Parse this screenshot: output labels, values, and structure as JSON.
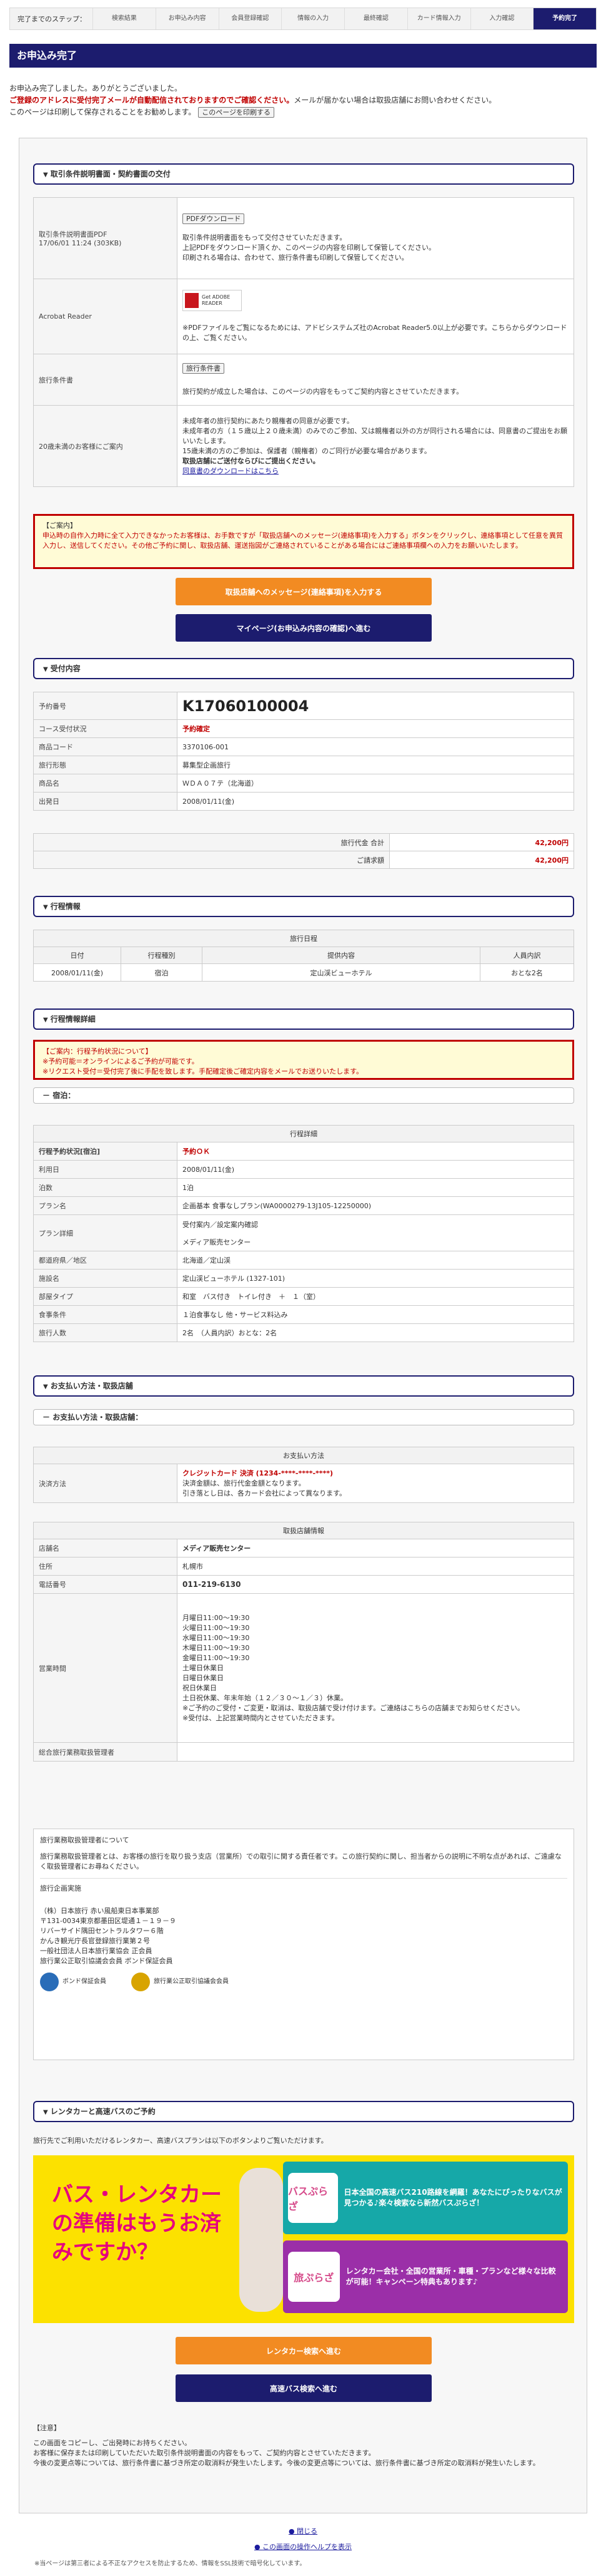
{
  "steps": {
    "current_label": "完了までのステップ：",
    "items": [
      "検索結果",
      "お申込み内容",
      "会員登録確認",
      "情報の入力",
      "最終確認",
      "カード情報入力",
      "入力確認",
      "予約完了"
    ]
  },
  "title": "お申込み完了",
  "intro": {
    "line1": "お申込み完了しました。ありがとうございました。",
    "line2_red": "ご登録のアドレスに受付完了メールが自動配信されておりますのでご確認ください。",
    "line2_rest": "メールが届かない場合は取扱店舗にお問い合わせください。",
    "line3": "このページは印刷して保存されることをお勧めします。",
    "print_button": "このページを印刷する"
  },
  "sec_docs": {
    "title": "取引条件説明書面・契約書面の交付",
    "rows": [
      {
        "label": "取引条件説明書面PDF",
        "sub": "17/06/01 11:24 (303KB)",
        "button": "PDFダウンロード",
        "text1": "取引条件説明書面をもって交付させていただきます。",
        "text2": "上記PDFをダウンロード頂くか、このページの内容を印刷して保管してください。",
        "text3": "印刷される場合は、合わせて、旅行条件書も印刷して保管してください。"
      },
      {
        "label": "Acrobat Reader",
        "logo_text": "Get ADOBE READER",
        "text1": "※PDFファイルをご覧になるためには、アドビシステムズ社のAcrobat Reader5.0以上が必要です。こちらからダウンロードの上、ご覧ください。"
      },
      {
        "label": "旅行条件書",
        "button": "旅行条件書",
        "text1": "旅行契約が成立した場合は、このページの内容をもってご契約内容とさせていただきます。"
      },
      {
        "label": "20歳未満のお客様にご案内",
        "text1": "未成年者の旅行契約にあたり親権者の同意が必要です。",
        "text2": "未成年者の方（１５歳以上２０歳未満）のみでのご参加、又は親権者以外の方が同行される場合には、同意書のご提出をお願いいたします。",
        "text3": "15歳未満の方のご参加は、保護者（親権者）のご同行が必要な場合があります。",
        "text4": "取扱店舗にご送付ならびにご提出ください。",
        "link": "同意書のダウンロードはこちら"
      }
    ]
  },
  "notice1": {
    "title": "【ご案内】",
    "body": "申込時の自作入力時に全て入力できなかったお客様は、お手数ですが「取扱店舗へのメッセージ(連絡事項)を入力する」ボタンをクリックし、連絡事項として任意を異質入力し、送信してください。その他ご予約に関し、取扱店舗、運送指図がご連絡されていることがある場合にはご連絡事項欄への入力をお願いいたします。"
  },
  "btn_message": "取扱店舗へのメッセージ(連絡事項)を入力する",
  "btn_mypage": "マイページ(お申込み内容の確認)へ進む",
  "sec_reception": {
    "title": "受付内容",
    "rows": [
      {
        "label": "予約番号",
        "value": "K17060100004"
      },
      {
        "label": "コース受付状況",
        "value": "予約確定"
      },
      {
        "label": "商品コード",
        "value": "3370106-001"
      },
      {
        "label": "旅行形態",
        "value": "募集型企画旅行"
      },
      {
        "label": "商品名",
        "value": "ＷＤＡ０７テ（北海道）"
      },
      {
        "label": "出発日",
        "value": "2008/01/11(金)"
      }
    ],
    "totals": [
      {
        "label": "旅行代金 合計",
        "value": "42,200円"
      },
      {
        "label": "ご請求額",
        "value": "42,200円"
      }
    ]
  },
  "sec_itinerary": {
    "title": "行程情報",
    "table_title": "旅行日程",
    "headers": [
      "日付",
      "行程種別",
      "提供内容",
      "人員内訳"
    ],
    "row": [
      "2008/01/11(金)",
      "宿泊",
      "定山渓ビューホテル",
      "おとな2名"
    ]
  },
  "sec_detail": {
    "title": "行程情報詳細",
    "notice_title": "【ご案内：行程予約状況について】",
    "notice_lines": [
      "※予約可能＝オンラインによるご予約が可能です。",
      "※リクエスト受付＝受付完了後に手配を致します。手配確定後ご確定内容をメールでお送りいたします。"
    ],
    "sub": "宿泊",
    "table_title": "行程詳細",
    "rows": [
      {
        "label": "行程予約状況[宿泊]",
        "value": "予約ＯＫ"
      },
      {
        "label": "利用日",
        "value": "2008/01/11(金)"
      },
      {
        "label": "泊数",
        "value": "1泊"
      },
      {
        "label": "プラン名",
        "value": "企画基本 食事なしプラン(WA0000279-13J105-12250000)"
      },
      {
        "label": "プラン詳細",
        "value": "受付案内／設定案内確認",
        "value2": "メディア販売センター"
      },
      {
        "label": "都道府県／地区",
        "value": "北海道／定山渓"
      },
      {
        "label": "施設名",
        "value": "定山渓ビューホテル (1327-101)"
      },
      {
        "label": "部屋タイプ",
        "value": "和室　バス付き　トイレ付き　＋　１（室）"
      },
      {
        "label": "食事条件",
        "value": "１泊食事なし 他・サービス料込み"
      },
      {
        "label": "旅行人数",
        "value": "2名　（人員内訳）おとな：2名"
      }
    ]
  },
  "sec_payment": {
    "title": "お支払い方法・取扱店舗",
    "sub": "お支払い方法・取扱店舗",
    "pay_title": "お支払い方法",
    "pay_label": "決済方法",
    "pay_value": "クレジットカード 決済 (1234-****-****-****)",
    "pay_note1": "決済金額は、旅行代金金額となります。",
    "pay_note2": "引き落とし日は、各カード会社によって異なります。",
    "shop_title": "取扱店舗情報",
    "shop_rows": [
      {
        "label": "店舗名",
        "value": "メディア販売センター"
      },
      {
        "label": "住所",
        "value": "札幌市"
      },
      {
        "label": "電話番号",
        "value": "011-219-6130"
      }
    ],
    "hours_label": "営業時間",
    "hours": [
      "月曜日11:00〜19:30",
      "火曜日11:00〜19:30",
      "水曜日11:00〜19:30",
      "木曜日11:00〜19:30",
      "金曜日11:00〜19:30",
      "土曜日休業日",
      "日曜日休業日",
      "祝日休業日",
      "土日祝休業、年末年始（１２／３０～１／３）休業。",
      "※ご予約のご受付・ご変更・取消は、取扱店舗で受け付けます。ご連絡はこちらの店舗までお知らせください。",
      "※受付は、上記営業時間内とさせていただきます。"
    ],
    "manager_label": "総合旅行業務取扱管理者",
    "manager_title": "旅行業務取扱管理者について",
    "manager_text": "旅行業務取扱管理者とは、お客様の旅行を取り扱う支店（営業所）での取引に関する責任者です。この旅行契約に関し、担当者からの説明に不明な点があれば、ご遠慮なく取扱管理者にお尋ねください。",
    "company_title": "旅行企画実施",
    "company_lines": [
      "（株）日本旅行 赤い風船東日本事業部",
      "〒131-0034東京都墨田区堤通１－１９－９",
      "リバーサイド隅田セントラルタワー６階",
      "かんき観光庁長官登録旅行業第２号",
      "一般社団法人日本旅行業協会 正会員",
      "旅行業公正取引協議会会員 ボンド保証会員"
    ],
    "logo1": "ボンド保証会員",
    "logo2": "旅行業公正取引協議会会員"
  },
  "sec_rental": {
    "title": "レンタカーと高速バスのご予約",
    "text": "旅行先でご利用いただけるレンタカー、高速バスプランは以下のボタンよりご覧いただけます。",
    "banner_main": "バス・レンタカーの準備はもうお済みですか？",
    "banner_bus": "日本全国の高速バス210路線を網羅！あなたにぴったりなバスが見つかる♪楽々検索なら新然バスぷらざ！",
    "banner_car": "レンタカー会社・全国の営業所・車種・プランなど様々な比較が可能！キャンペーン特典もあります♪",
    "brand_bus": "バスぷらざ",
    "brand_car": "旅ぷらざ",
    "btn_rental": "レンタカー検索へ進む",
    "btn_bus": "高速バス検索へ進む"
  },
  "caution": {
    "title": "【注意】",
    "lines": [
      "この画面をコピーし、ご出発時にお持ちください。",
      "お客様に保存または印刷していただいた取引条件説明書面の内容をもって、ご契約内容とさせていただきます。",
      "今後の変更点等については、旅行条件書に基づき所定の取消料が発生いたします。今後の変更点等については、旅行条件書に基づき所定の取消料が発生いたします。"
    ]
  },
  "footer": {
    "link_top": "閉じる",
    "link_help": "この画面の操作ヘルプを表示",
    "note": "※当ページは第三者による不正なアクセスを防止するため、情報をSSL技術で暗号化しています。"
  },
  "colors": {
    "navy": "#1c1c6e",
    "orange": "#f28b22",
    "red": "#c00000",
    "banner_yellow": "#fce100",
    "banner_teal": "#16a8a8",
    "banner_purple": "#9b2fa8"
  }
}
